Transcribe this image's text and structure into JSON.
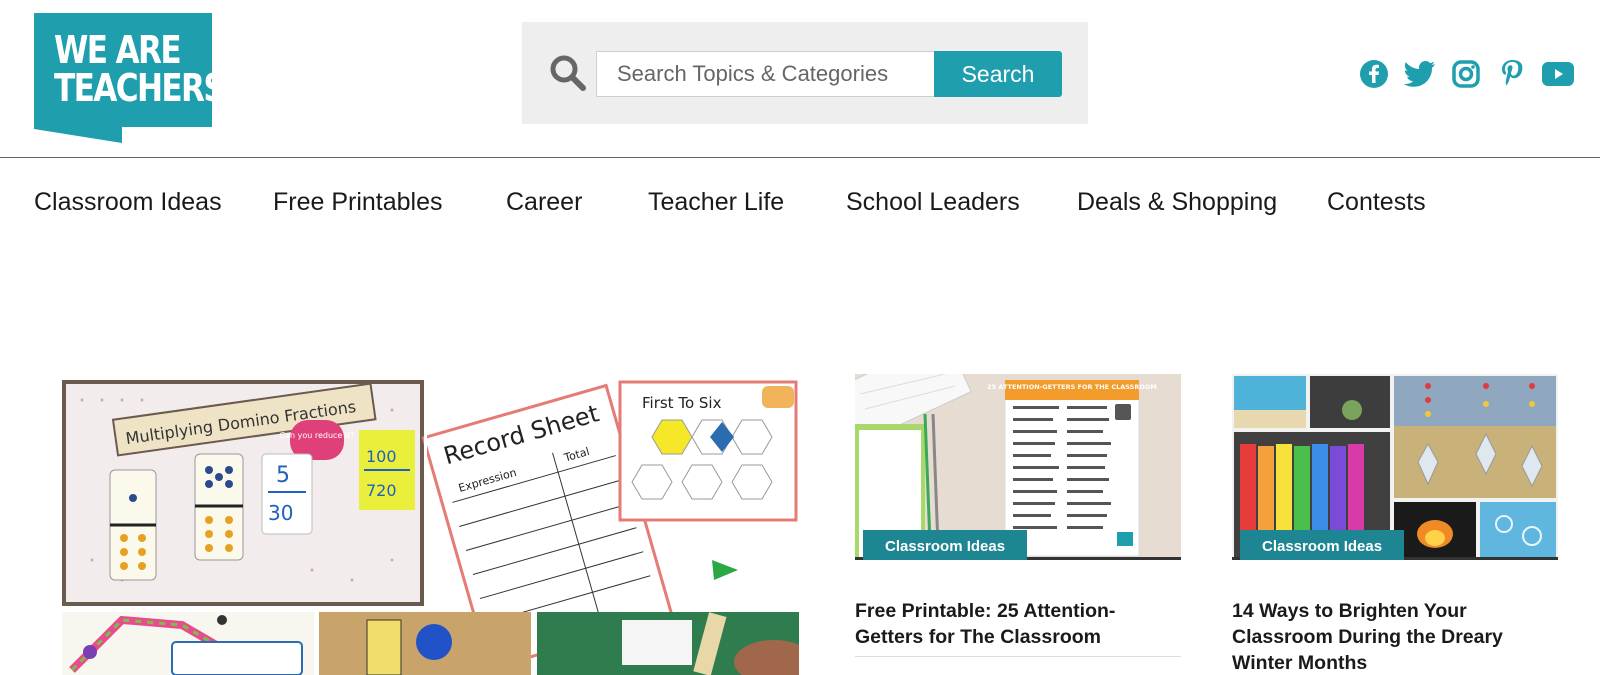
{
  "logo": {
    "line1": "WE ARE",
    "line2": "TEACHERS"
  },
  "search": {
    "placeholder": "Search Topics & Categories",
    "button_label": "Search"
  },
  "social": [
    "facebook-icon",
    "twitter-icon",
    "instagram-icon",
    "pinterest-icon",
    "youtube-icon"
  ],
  "nav": {
    "items": [
      {
        "label": "Classroom Ideas"
      },
      {
        "label": "Free Printables"
      },
      {
        "label": "Career"
      },
      {
        "label": "Teacher Life"
      },
      {
        "label": "School Leaders"
      },
      {
        "label": "Deals & Shopping"
      },
      {
        "label": "Contests"
      }
    ]
  },
  "hero": {
    "domino_title": "Multiplying Domino Fractions",
    "bubble": "Can you reduce it?",
    "sheet_title": "Record Sheet",
    "sheet_col1": "Expression",
    "sheet_col2": "Total",
    "game_title": "First To Six"
  },
  "cards": [
    {
      "category": "Classroom Ideas",
      "title": "Free Printable: 25 Attention-Getters for The Classroom",
      "poster_title": "25 ATTENTION-GETTERS FOR THE CLASSROOM"
    },
    {
      "category": "Classroom Ideas",
      "title": "14 Ways to Brighten Your Classroom During the Dreary Winter Months"
    }
  ],
  "colors": {
    "brand": "#1f9fad",
    "badge": "#1e8593"
  }
}
